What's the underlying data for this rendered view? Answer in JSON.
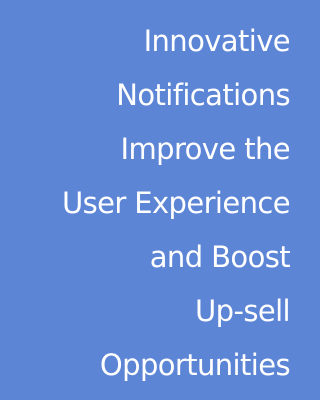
{
  "banner": {
    "background_color": "#5d85d6",
    "text_color": "#ffffff",
    "headline_lines": [
      "Innovative",
      "Notifications",
      "Improve the",
      "User Experience",
      "and Boost",
      "Up-sell",
      "Opportunities"
    ]
  }
}
